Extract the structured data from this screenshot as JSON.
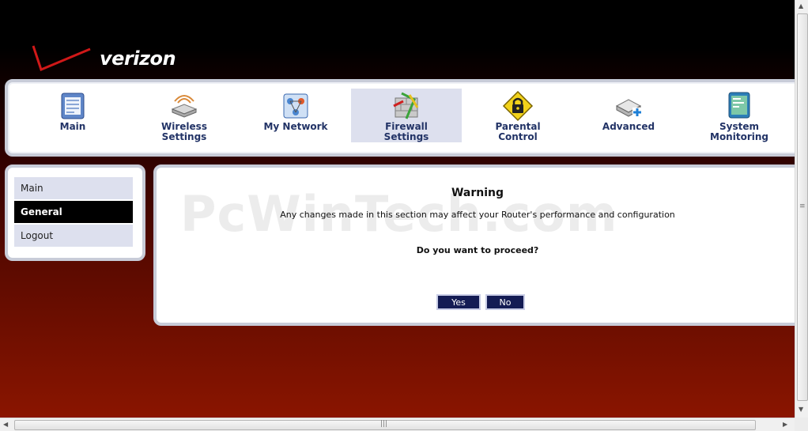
{
  "logo": {
    "text": "verizon"
  },
  "nav": {
    "items": [
      {
        "label": "Main",
        "icon": "main-page-icon"
      },
      {
        "label": "Wireless\nSettings",
        "icon": "wireless-router-icon"
      },
      {
        "label": "My Network",
        "icon": "network-icon"
      },
      {
        "label": "Firewall\nSettings",
        "icon": "firewall-icon",
        "active": true
      },
      {
        "label": "Parental\nControl",
        "icon": "lock-warning-icon"
      },
      {
        "label": "Advanced",
        "icon": "advanced-tools-icon"
      },
      {
        "label": "System\nMonitoring",
        "icon": "monitor-icon"
      }
    ]
  },
  "sidebar": {
    "items": [
      {
        "label": "Main"
      },
      {
        "label": "General",
        "active": true
      },
      {
        "label": "Logout"
      }
    ]
  },
  "main": {
    "watermark": "PcWinTech.com",
    "title": "Warning",
    "message": "Any changes made in this section may affect your Router's performance and configuration",
    "question": "Do you want to proceed?",
    "yes_label": "Yes",
    "no_label": "No"
  },
  "colors": {
    "nav_label": "#223366",
    "active_bg": "#dde0ee",
    "button_bg": "#141c54",
    "brand_red": "#cc0000"
  }
}
